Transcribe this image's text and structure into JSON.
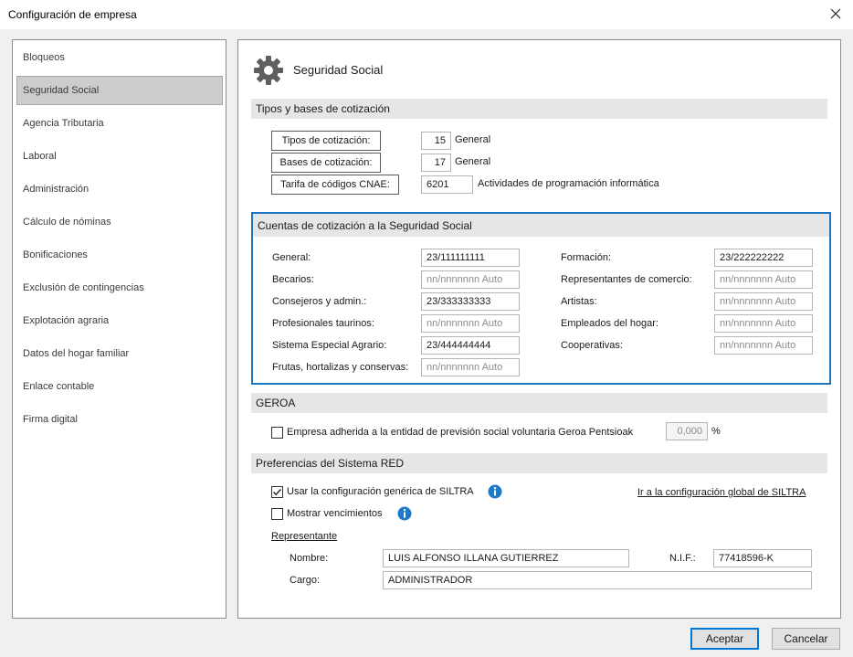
{
  "window": {
    "title": "Configuración de empresa"
  },
  "sidebar": {
    "items": [
      {
        "label": "Bloqueos"
      },
      {
        "label": "Seguridad Social"
      },
      {
        "label": "Agencia Tributaria"
      },
      {
        "label": "Laboral"
      },
      {
        "label": "Administración"
      },
      {
        "label": "Cálculo de nóminas"
      },
      {
        "label": "Bonificaciones"
      },
      {
        "label": "Exclusión de contingencias"
      },
      {
        "label": "Explotación agraria"
      },
      {
        "label": "Datos del hogar familiar"
      },
      {
        "label": "Enlace contable"
      },
      {
        "label": "Firma digital"
      }
    ],
    "active": "Seguridad Social"
  },
  "main": {
    "title": "Seguridad Social",
    "tipos": {
      "header": "Tipos y bases de cotización",
      "tipos_btn": "Tipos de cotización:",
      "tipos_val": "15",
      "tipos_desc": "General",
      "bases_btn": "Bases de cotización:",
      "bases_val": "17",
      "bases_desc": "General",
      "cnae_btn": "Tarifa de códigos CNAE:",
      "cnae_val": "6201",
      "cnae_desc": "Actividades de programación informática"
    },
    "cuentas": {
      "header": "Cuentas de cotización a la Seguridad Social",
      "left": [
        {
          "label": "General:",
          "value": "23/111111111",
          "placeholder": false
        },
        {
          "label": "Becarios:",
          "value": "nn/nnnnnnn Auto",
          "placeholder": true
        },
        {
          "label": "Consejeros y admin.:",
          "value": "23/333333333",
          "placeholder": false
        },
        {
          "label": "Profesionales taurinos:",
          "value": "nn/nnnnnnn Auto",
          "placeholder": true
        },
        {
          "label": "Sistema Especial Agrario:",
          "value": "23/444444444",
          "placeholder": false
        },
        {
          "label": "Frutas, hortalizas y conservas:",
          "value": "nn/nnnnnnn Auto",
          "placeholder": true
        }
      ],
      "right": [
        {
          "label": "Formación:",
          "value": "23/222222222",
          "placeholder": false
        },
        {
          "label": "Representantes de comercio:",
          "value": "nn/nnnnnnn Auto",
          "placeholder": true
        },
        {
          "label": "Artistas:",
          "value": "nn/nnnnnnn Auto",
          "placeholder": true
        },
        {
          "label": "Empleados del hogar:",
          "value": "nn/nnnnnnn Auto",
          "placeholder": true
        },
        {
          "label": "Cooperativas:",
          "value": "nn/nnnnnnn Auto",
          "placeholder": true
        }
      ]
    },
    "geroa": {
      "header": "GEROA",
      "checkbox_label": "Empresa adherida a la entidad de previsión social voluntaria Geroa Pentsioak",
      "checked": false,
      "percent_value": "0,000",
      "percent_sign": "%"
    },
    "red": {
      "header": "Preferencias del Sistema RED",
      "usar_label": "Usar la configuración genérica de SILTRA",
      "usar_checked": true,
      "mostrar_label": "Mostrar vencimientos",
      "mostrar_checked": false,
      "link": "Ir a la configuración global de SILTRA",
      "representante": "Representante",
      "nombre_label": "Nombre:",
      "nombre_value": "LUIS ALFONSO ILLANA GUTIERREZ",
      "nif_label": "N.I.F.:",
      "nif_value": "77418596-K",
      "cargo_label": "Cargo:",
      "cargo_value": "ADMINISTRADOR"
    }
  },
  "footer": {
    "accept": "Aceptar",
    "cancel": "Cancelar"
  },
  "colors": {
    "accent": "#1977c4",
    "info": "#1e7ac8",
    "active_item": "#cccccc"
  }
}
